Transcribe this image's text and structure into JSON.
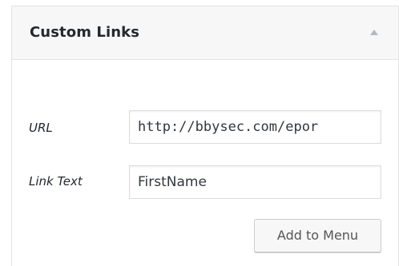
{
  "panel": {
    "title": "Custom Links",
    "toggle_icon": "arrow-up-icon"
  },
  "form": {
    "url_label": "URL",
    "url_value": "http://bbysec.com/epor",
    "link_text_label": "Link Text",
    "link_text_value": "FirstName",
    "add_button_label": "Add to Menu"
  },
  "colors": {
    "header_bg": "#f7f7f7",
    "border": "#e2e4e7",
    "text": "#23282d",
    "button_text": "#555555"
  }
}
